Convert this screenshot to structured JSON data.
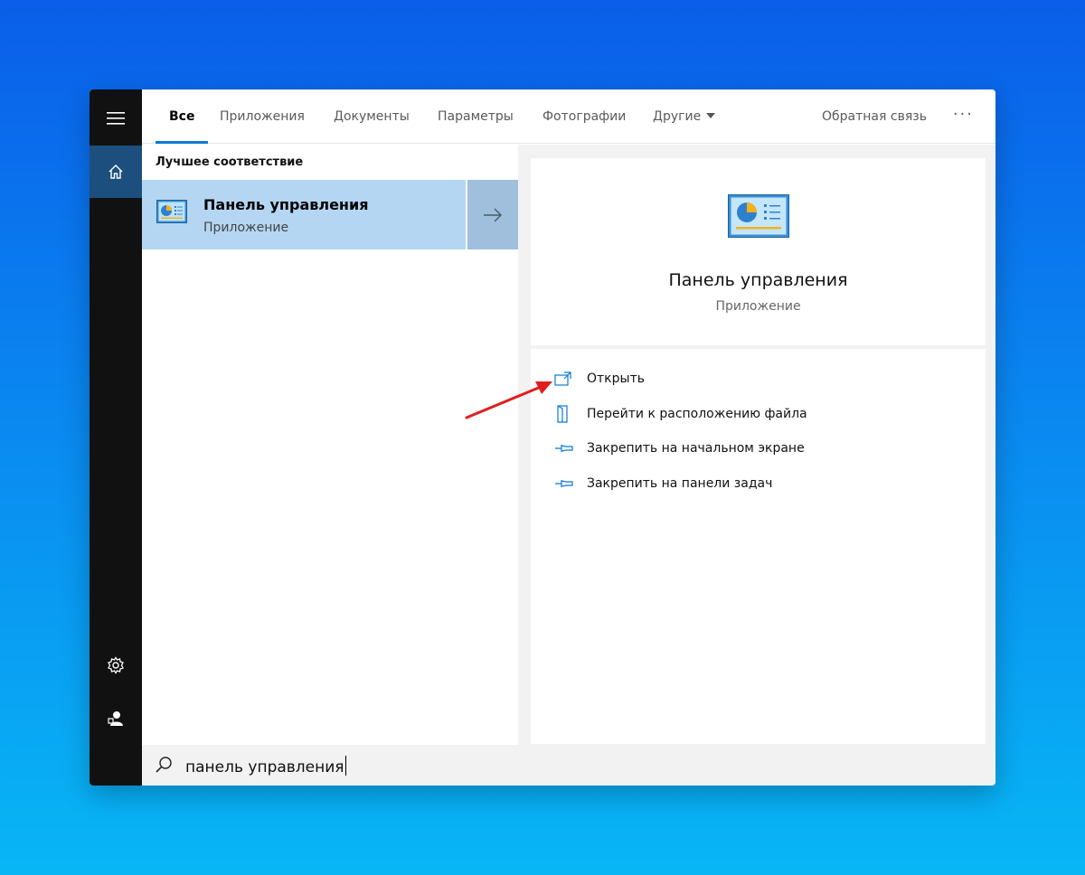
{
  "colors": {
    "accent": "#0a78d7",
    "rail": "#111111",
    "selection": "#b4d6f2",
    "annotation_arrow": "#e01e1e"
  },
  "tabs": [
    {
      "label": "Все"
    },
    {
      "label": "Приложения"
    },
    {
      "label": "Документы"
    },
    {
      "label": "Параметры"
    },
    {
      "label": "Фотографии"
    },
    {
      "label": "Другие"
    }
  ],
  "feedback_label": "Обратная связь",
  "more_label": "···",
  "results": {
    "section_title": "Лучшее соответствие",
    "best_match": {
      "title": "Панель управления",
      "subtitle": "Приложение"
    }
  },
  "detail": {
    "title": "Панель управления",
    "subtitle": "Приложение",
    "actions": [
      {
        "label": "Открыть",
        "icon": "open-icon"
      },
      {
        "label": "Перейти к расположению файла",
        "icon": "file-location-icon"
      },
      {
        "label": "Закрепить на начальном экране",
        "icon": "pin-icon"
      },
      {
        "label": "Закрепить на панели задач",
        "icon": "pin-icon"
      }
    ]
  },
  "search": {
    "value": "панель управления"
  },
  "rail_icons": [
    "hamburger-menu-icon",
    "home-icon",
    "settings-gear-icon",
    "user-icon"
  ]
}
